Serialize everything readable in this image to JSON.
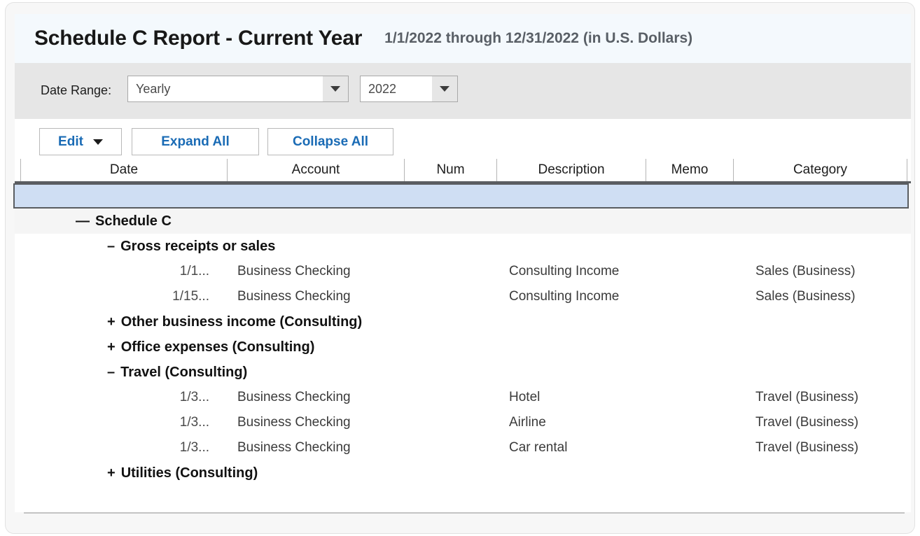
{
  "window": {
    "title": "Schedule C Report - Current Year",
    "subtitle": "1/1/2022 through 12/31/2022 (in U.S. Dollars)"
  },
  "toolbar": {
    "date_range_label": "Date Range:",
    "period_value": "Yearly",
    "period_placeholder": "Yearly",
    "year_value": "2022",
    "year_placeholder": "2022",
    "dropdown_icon": "chevron-down-icon"
  },
  "buttons": {
    "edit_label": "Edit",
    "edit_caret_icon": "caret-down-icon",
    "expand_all_label": "Expand All",
    "collapse_all_label": "Collapse All",
    "accent_color": "#1a6bb5"
  },
  "table": {
    "columns": [
      {
        "key": "date",
        "label": "Date"
      },
      {
        "key": "account",
        "label": "Account"
      },
      {
        "key": "num",
        "label": "Num"
      },
      {
        "key": "description",
        "label": "Description"
      },
      {
        "key": "memo",
        "label": "Memo"
      },
      {
        "key": "category",
        "label": "Category"
      }
    ],
    "selected_row_color": "#cfdef3",
    "rows": [
      {
        "kind": "group",
        "level": 0,
        "twisty": "—",
        "label": "Schedule C"
      },
      {
        "kind": "group",
        "level": 1,
        "twisty": "–",
        "label": "Gross receipts or sales"
      },
      {
        "kind": "transaction",
        "date": "1/1...",
        "account": "Business Checking",
        "num": "",
        "description": "Consulting Income",
        "memo": "",
        "category": "Sales (Business)"
      },
      {
        "kind": "transaction",
        "date": "1/15...",
        "account": "Business Checking",
        "num": "",
        "description": "Consulting Income",
        "memo": "",
        "category": "Sales (Business)"
      },
      {
        "kind": "group",
        "level": 1,
        "twisty": "+",
        "label": "Other business income (Consulting)"
      },
      {
        "kind": "group",
        "level": 1,
        "twisty": "+",
        "label": "Office expenses (Consulting)"
      },
      {
        "kind": "group",
        "level": 1,
        "twisty": "–",
        "label": "Travel (Consulting)"
      },
      {
        "kind": "transaction",
        "date": "1/3...",
        "account": "Business Checking",
        "num": "",
        "description": "Hotel",
        "memo": "",
        "category": "Travel (Business)"
      },
      {
        "kind": "transaction",
        "date": "1/3...",
        "account": "Business Checking",
        "num": "",
        "description": "Airline",
        "memo": "",
        "category": "Travel (Business)"
      },
      {
        "kind": "transaction",
        "date": "1/3...",
        "account": "Business Checking",
        "num": "",
        "description": "Car rental",
        "memo": "",
        "category": "Travel (Business)"
      },
      {
        "kind": "group",
        "level": 1,
        "twisty": "+",
        "label": "Utilities (Consulting)"
      }
    ]
  }
}
